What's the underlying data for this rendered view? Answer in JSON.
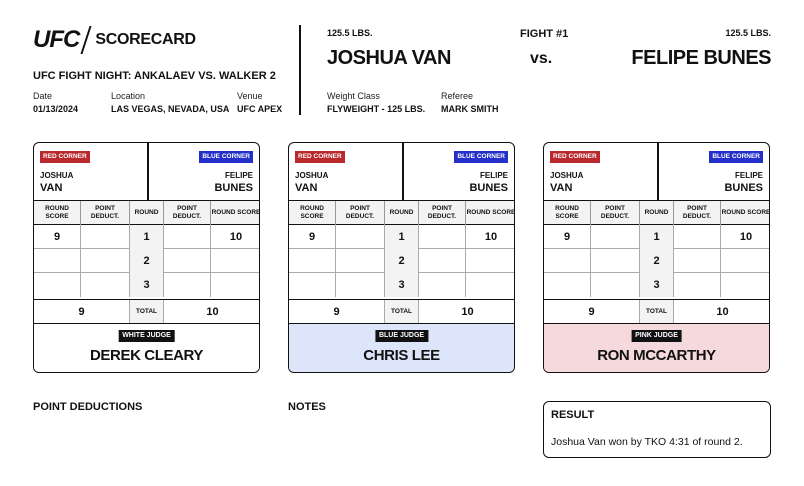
{
  "header": {
    "logo": "UFC",
    "doc_title": "SCORECARD",
    "event": "UFC FIGHT NIGHT: ANKALAEV VS. WALKER 2",
    "date_label": "Date",
    "date": "01/13/2024",
    "location_label": "Location",
    "location": "LAS VEGAS, NEVADA, USA",
    "venue_label": "Venue",
    "venue": "UFC APEX"
  },
  "fight": {
    "number": "FIGHT #1",
    "vs": "vs.",
    "red_weight": "125.5 LBS.",
    "blue_weight": "125.5 LBS.",
    "red_fighter": "JOSHUA VAN",
    "blue_fighter": "FELIPE BUNES",
    "weight_class_label": "Weight Class",
    "weight_class": "FLYWEIGHT - 125 LBS.",
    "referee_label": "Referee",
    "referee": "MARK SMITH"
  },
  "card_labels": {
    "red_corner": "RED CORNER",
    "blue_corner": "BLUE CORNER",
    "red_first": "JOSHUA",
    "red_last": "VAN",
    "blue_first": "FELIPE",
    "blue_last": "BUNES",
    "col_round_score": "ROUND SCORE",
    "col_point_deduct": "POINT DEDUCT.",
    "col_round": "ROUND",
    "total": "TOTAL",
    "rounds": [
      "1",
      "2",
      "3"
    ]
  },
  "scorecards": [
    {
      "judge_tag": "WHITE JUDGE",
      "judge_name": "DEREK CLEARY",
      "tint": "#ffffff",
      "red_scores": [
        "9",
        "",
        ""
      ],
      "red_deduct": [
        "",
        "",
        ""
      ],
      "blue_deduct": [
        "",
        "",
        ""
      ],
      "blue_scores": [
        "10",
        "",
        ""
      ],
      "red_total": "9",
      "blue_total": "10"
    },
    {
      "judge_tag": "BLUE JUDGE",
      "judge_name": "CHRIS LEE",
      "tint": "#dde5fb",
      "red_scores": [
        "9",
        "",
        ""
      ],
      "red_deduct": [
        "",
        "",
        ""
      ],
      "blue_deduct": [
        "",
        "",
        ""
      ],
      "blue_scores": [
        "10",
        "",
        ""
      ],
      "red_total": "9",
      "blue_total": "10"
    },
    {
      "judge_tag": "PINK JUDGE",
      "judge_name": "RON MCCARTHY",
      "tint": "#f6d9dd",
      "red_scores": [
        "9",
        "",
        ""
      ],
      "red_deduct": [
        "",
        "",
        ""
      ],
      "blue_deduct": [
        "",
        "",
        ""
      ],
      "blue_scores": [
        "10",
        "",
        ""
      ],
      "red_total": "9",
      "blue_total": "10"
    }
  ],
  "footer": {
    "point_deductions_title": "POINT DEDUCTIONS",
    "notes_title": "NOTES",
    "result_title": "RESULT",
    "result_text": "Joshua Van won by TKO 4:31 of round 2."
  },
  "colors": {
    "red_corner": "#b8282d",
    "blue_corner": "#2430c9"
  }
}
